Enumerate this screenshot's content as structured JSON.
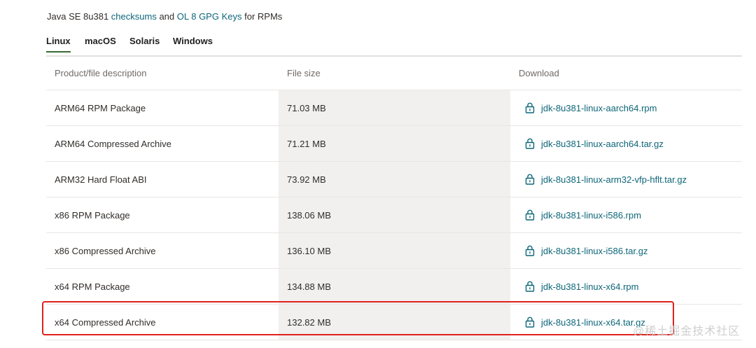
{
  "intro": {
    "prefix": "Java SE 8u381 ",
    "checksums_link": "checksums",
    "middle": " and ",
    "gpg_link": "OL 8 GPG Keys",
    "suffix": " for RPMs"
  },
  "tabs": [
    {
      "label": "Linux",
      "active": true
    },
    {
      "label": "macOS",
      "active": false
    },
    {
      "label": "Solaris",
      "active": false
    },
    {
      "label": "Windows",
      "active": false
    }
  ],
  "table": {
    "headers": {
      "description": "Product/file description",
      "size": "File size",
      "download": "Download"
    },
    "rows": [
      {
        "description": "ARM64 RPM Package",
        "size": "71.03 MB",
        "file": "jdk-8u381-linux-aarch64.rpm"
      },
      {
        "description": "ARM64 Compressed Archive",
        "size": "71.21 MB",
        "file": "jdk-8u381-linux-aarch64.tar.gz"
      },
      {
        "description": "ARM32 Hard Float ABI",
        "size": "73.92 MB",
        "file": "jdk-8u381-linux-arm32-vfp-hflt.tar.gz"
      },
      {
        "description": "x86 RPM Package",
        "size": "138.06 MB",
        "file": "jdk-8u381-linux-i586.rpm"
      },
      {
        "description": "x86 Compressed Archive",
        "size": "136.10 MB",
        "file": "jdk-8u381-linux-i586.tar.gz"
      },
      {
        "description": "x64 RPM Package",
        "size": "134.88 MB",
        "file": "jdk-8u381-linux-x64.rpm"
      },
      {
        "description": "x64 Compressed Archive",
        "size": "132.82 MB",
        "file": "jdk-8u381-linux-x64.tar.gz"
      }
    ]
  },
  "watermark": "@稀土掘金技术社区",
  "colors": {
    "link": "#0d6679",
    "active_tab_underline": "#3a6b35",
    "size_column_bg": "#f1f0ee",
    "highlight_border": "#e0211d"
  },
  "icons": {
    "download_lock": "lock-icon"
  }
}
